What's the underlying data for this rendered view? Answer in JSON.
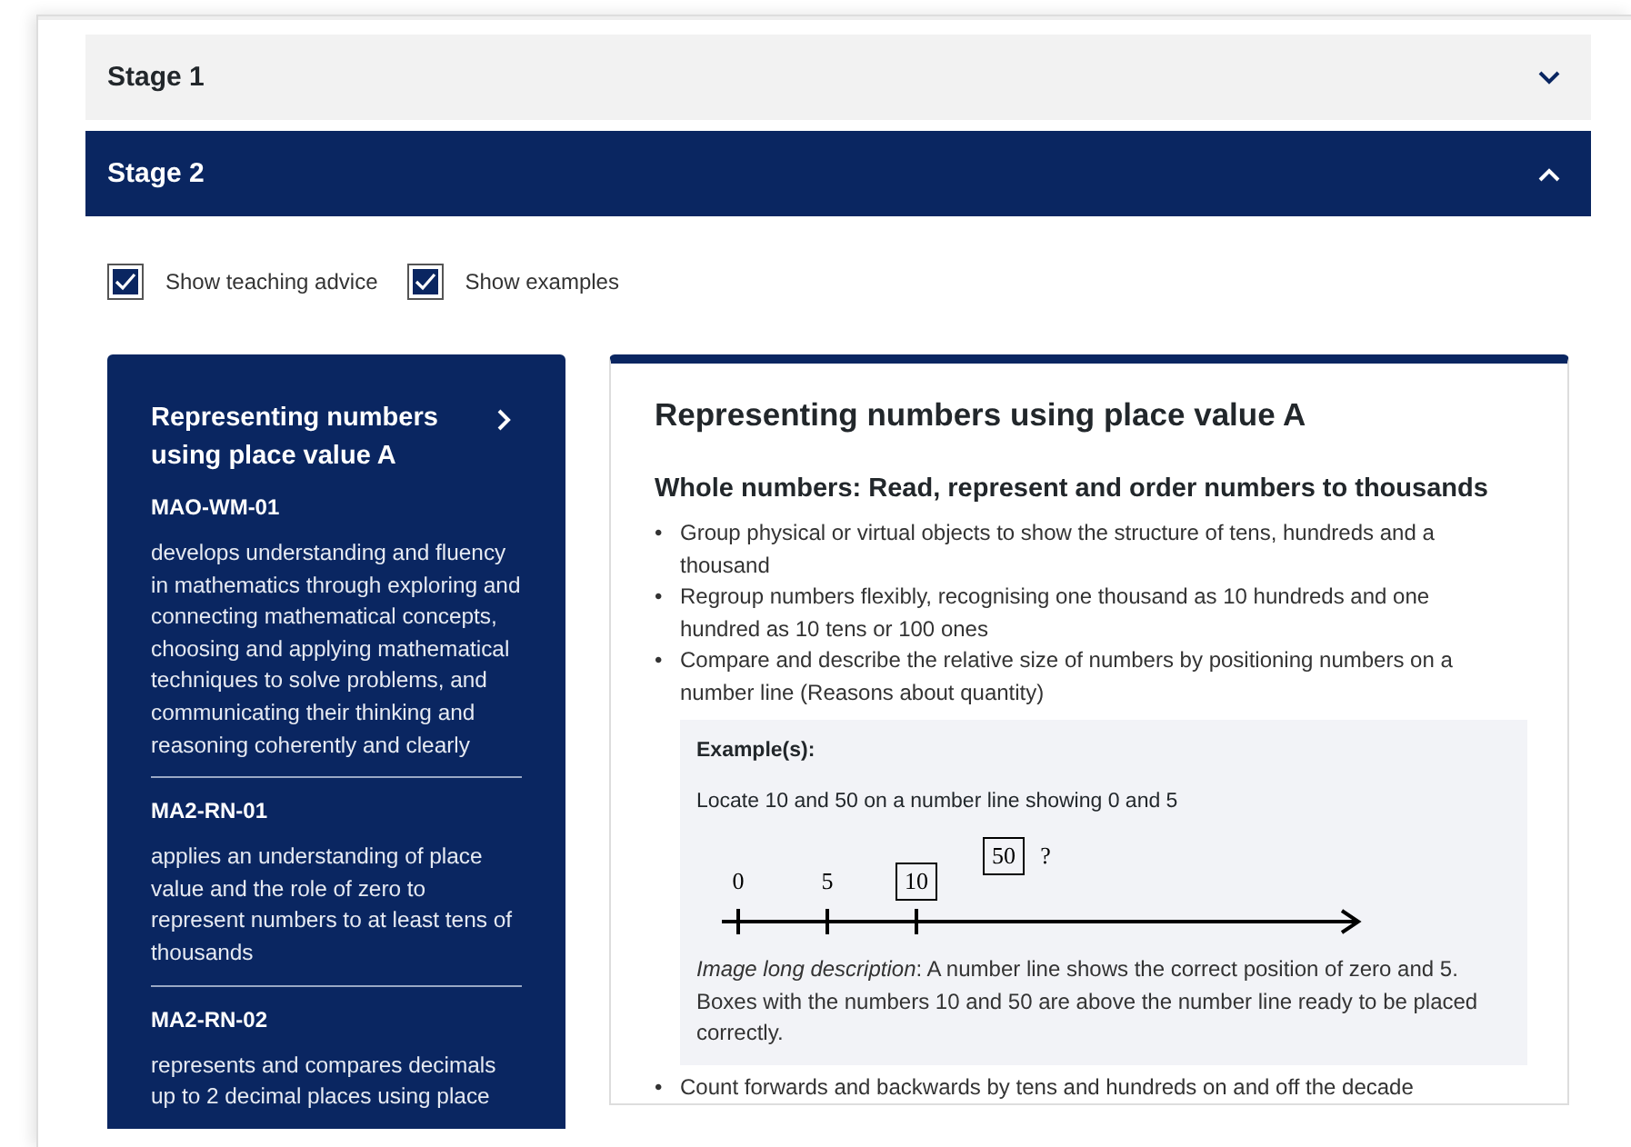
{
  "accordion": [
    {
      "title": "Stage 1",
      "expanded": false
    },
    {
      "title": "Stage 2",
      "expanded": true
    }
  ],
  "options": [
    {
      "label": "Show teaching advice",
      "checked": true
    },
    {
      "label": "Show examples",
      "checked": true
    }
  ],
  "sidebar": {
    "title": "Representing numbers using place value A",
    "outcomes": [
      {
        "code": "MAO-WM-01",
        "text": "develops understanding and fluency in mathematics through exploring and connecting mathematical concepts, choosing and applying mathematical techniques to solve problems, and communicating their thinking and reasoning coherently and clearly"
      },
      {
        "code": "MA2-RN-01",
        "text": "applies an understanding of place value and the role of zero to represent numbers to at least tens of thousands"
      },
      {
        "code": "MA2-RN-02",
        "text": "represents and compares decimals up to 2 decimal places using place"
      }
    ]
  },
  "content": {
    "title": "Representing numbers using place value A",
    "subtitle": "Whole numbers: Read, represent and order numbers to thousands",
    "bullets": [
      {
        "marker": "•",
        "text": "Group physical or virtual objects to show the structure of tens, hundreds and a thousand"
      },
      {
        "marker": "•",
        "text": "Regroup numbers flexibly, recognising one thousand as 10 hundreds and one hundred as 10 tens or 100 ones"
      },
      {
        "marker": "•",
        "text": "Compare and describe the relative size of numbers by positioning numbers on a number line (Reasons about quantity)"
      }
    ],
    "example": {
      "heading": "Example(s):",
      "prompt": "Locate 10 and 50 on a number line showing 0 and 5",
      "number_line": [
        {
          "kind": "tick",
          "label": "0"
        },
        {
          "kind": "tick",
          "label": "5"
        },
        {
          "kind": "boxed_tick",
          "label": "10"
        },
        {
          "kind": "floating_box",
          "label": "50"
        },
        {
          "kind": "floating_text",
          "label": "?"
        }
      ],
      "description": "*Image long description*: A number line shows the correct position of zero and 5. Boxes with the numbers 10 and 50 are above the number line ready to be placed correctly."
    },
    "more_bullets": [
      {
        "marker": "•",
        "text": "Count forwards and backwards by tens and hundreds on and off the decade"
      }
    ]
  }
}
